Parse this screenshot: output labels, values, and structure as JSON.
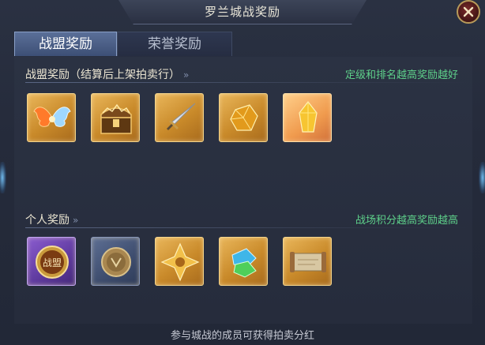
{
  "window": {
    "title": "罗兰城战奖励"
  },
  "tabs": [
    {
      "label": "战盟奖励",
      "active": true
    },
    {
      "label": "荣誉奖励",
      "active": false
    }
  ],
  "sections": [
    {
      "title": "战盟奖励（结算后上架拍卖行）",
      "hint": "定级和排名越高奖励越好",
      "items": [
        {
          "icon": "wings-icon",
          "rarity": "gold"
        },
        {
          "icon": "treasure-chest-icon",
          "rarity": "gold"
        },
        {
          "icon": "dagger-icon",
          "rarity": "gold"
        },
        {
          "icon": "amber-gem-icon",
          "rarity": "gold"
        },
        {
          "icon": "yellow-crystal-icon",
          "rarity": "orange"
        }
      ]
    },
    {
      "title": "个人奖励",
      "hint": "战场积分越高奖励越高",
      "items": [
        {
          "icon": "alliance-coin-icon",
          "rarity": "purple",
          "label": "战盟"
        },
        {
          "icon": "bronze-coin-icon",
          "rarity": "blue"
        },
        {
          "icon": "golden-emblem-icon",
          "rarity": "gold"
        },
        {
          "icon": "green-blue-gems-icon",
          "rarity": "gold"
        },
        {
          "icon": "scroll-icon",
          "rarity": "gold"
        }
      ]
    }
  ],
  "footer": {
    "text": "参与城战的成员可获得拍卖分红"
  },
  "colors": {
    "hint_green": "#5ed18a",
    "tab_active": "#4a5f88",
    "panel_bg": "#262c3c"
  }
}
